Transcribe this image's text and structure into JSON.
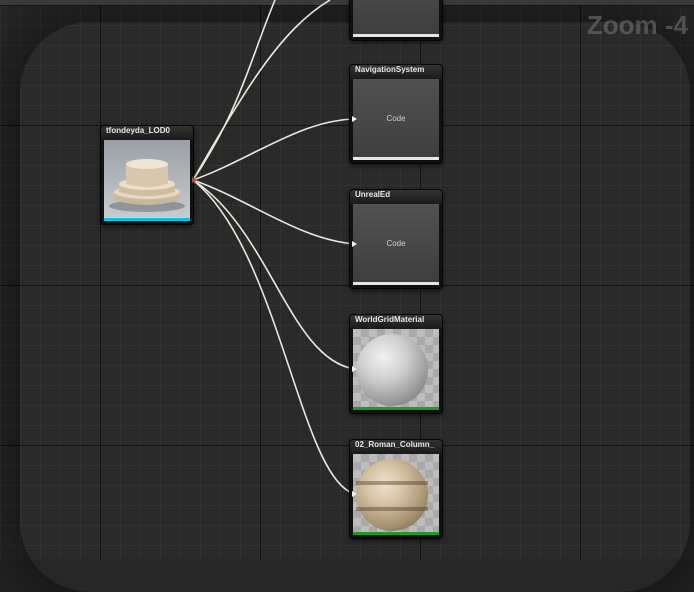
{
  "viewport": {
    "zoom_label": "Zoom -4"
  },
  "nodes": {
    "source": {
      "title": "tfondeyda_LOD0",
      "type": "static-mesh",
      "bar_color": "#00c8e6"
    },
    "top_partial": {
      "type": "code",
      "bar_color": "#e6e6e6"
    },
    "navigation": {
      "title": "NavigationSystem",
      "label": "Code",
      "type": "code",
      "bar_color": "#e6e6e6"
    },
    "unrealed": {
      "title": "UnrealEd",
      "label": "Code",
      "type": "code",
      "bar_color": "#e6e6e6"
    },
    "worldgrid": {
      "title": "WorldGridMaterial",
      "type": "material",
      "bar_color": "#1e9a2a"
    },
    "roman_column": {
      "title": "02_Roman_Column_",
      "type": "material",
      "bar_color": "#1e9a2a"
    }
  },
  "colors": {
    "wire": "#e8e8da",
    "background": "#262626"
  }
}
